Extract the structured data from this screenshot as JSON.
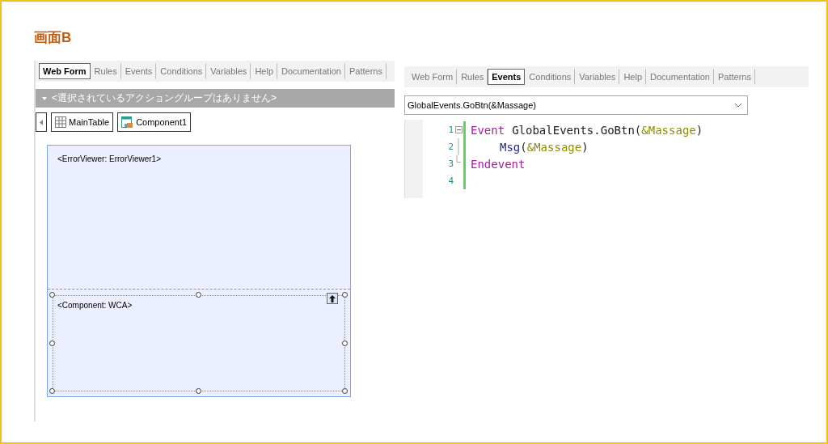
{
  "title": "画面B",
  "left_panel": {
    "tabs": [
      {
        "label": "Web Form",
        "selected": true
      },
      {
        "label": "Rules",
        "selected": false
      },
      {
        "label": "Events",
        "selected": false
      },
      {
        "label": "Conditions",
        "selected": false
      },
      {
        "label": "Variables",
        "selected": false
      },
      {
        "label": "Help",
        "selected": false
      },
      {
        "label": "Documentation",
        "selected": false
      },
      {
        "label": "Patterns",
        "selected": false
      }
    ],
    "action_group_bar": {
      "text": "<選択されているアクショングループはありません>"
    },
    "breadcrumb": [
      {
        "label": "MainTable",
        "kind": "table"
      },
      {
        "label": "Component1",
        "kind": "component"
      }
    ],
    "form": {
      "error_viewer": "<ErrorViewer: ErrorViewer1>",
      "component": {
        "label": "<Component: WCA>",
        "selected": true
      }
    }
  },
  "right_panel": {
    "tabs": [
      {
        "label": "Web Form",
        "selected": false
      },
      {
        "label": "Rules",
        "selected": false
      },
      {
        "label": "Events",
        "selected": true
      },
      {
        "label": "Conditions",
        "selected": false
      },
      {
        "label": "Variables",
        "selected": false
      },
      {
        "label": "Help",
        "selected": false
      },
      {
        "label": "Documentation",
        "selected": false
      },
      {
        "label": "Patterns",
        "selected": false
      }
    ],
    "event_select": {
      "value": "GlobalEvents.GoBtn(&Massage)"
    },
    "code_lines": [
      {
        "number": "1",
        "kind": "fold_start",
        "indented": false,
        "tokens": [
          {
            "text": "Event",
            "kind": "keyword"
          },
          {
            "text": "GlobalEvents.GoBtn(",
            "kind": "plain"
          },
          {
            "text": "&Massage",
            "kind": "variable"
          },
          {
            "text": ")",
            "kind": "plain"
          }
        ]
      },
      {
        "number": "2",
        "kind": "fold_body",
        "indented": true,
        "tokens": [
          {
            "text": "Msg",
            "kind": "function"
          },
          {
            "text": "(",
            "kind": "plain"
          },
          {
            "text": "&Massage",
            "kind": "variable"
          },
          {
            "text": ")",
            "kind": "plain"
          }
        ]
      },
      {
        "number": "3",
        "kind": "fold_end",
        "indented": false,
        "tokens": [
          {
            "text": "Endevent",
            "kind": "keyword"
          }
        ]
      },
      {
        "number": "4",
        "kind": "plain"
      }
    ]
  }
}
